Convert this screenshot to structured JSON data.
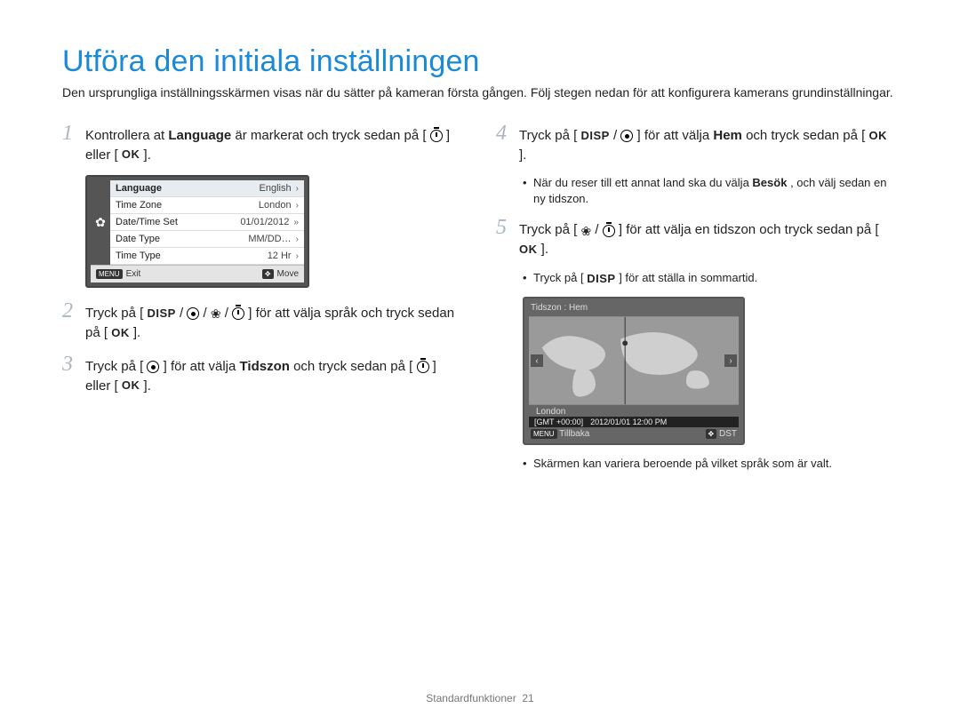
{
  "title": "Utföra den initiala inställningen",
  "intro": "Den ursprungliga inställningsskärmen visas när du sätter på kameran första gången. Följ stegen nedan för att konfigurera kamerans grundinställningar.",
  "icons": {
    "disp": "DISP",
    "ok": "OK",
    "menu": "MENU",
    "flower": "❀"
  },
  "step1": {
    "num": "1",
    "t1": "Kontrollera at ",
    "bold1": "Language",
    "t2": " är markerat och tryck sedan på [",
    "t3": "] eller [",
    "t4": "]."
  },
  "settings_lcd": {
    "rows": [
      {
        "label": "Language",
        "value": "English",
        "chev": "›",
        "selected": true
      },
      {
        "label": "Time Zone",
        "value": "London",
        "chev": "›"
      },
      {
        "label": "Date/Time Set",
        "value": "01/01/2012",
        "chev": "»"
      },
      {
        "label": "Date Type",
        "value": "MM/DD…",
        "chev": "›"
      },
      {
        "label": "Time Type",
        "value": "12 Hr",
        "chev": "›"
      }
    ],
    "foot_left": "Exit",
    "foot_right": "Move"
  },
  "step2": {
    "num": "2",
    "t1": "Tryck på [",
    "sep": "/",
    "t2": "] för att välja språk och tryck sedan på [",
    "t3": "]."
  },
  "step3": {
    "num": "3",
    "t1": "Tryck på [",
    "t2": "] för att välja ",
    "bold": "Tidszon",
    "t3": " och tryck sedan på [",
    "t4": "] eller [",
    "t5": "]."
  },
  "step4": {
    "num": "4",
    "t1": "Tryck på [",
    "sep": "/",
    "t2": "] för att välja ",
    "bold": "Hem",
    "t3": " och tryck sedan på [",
    "t4": "]."
  },
  "step4_bullet": {
    "t1": "När du reser till ett annat land ska du välja ",
    "bold": "Besök",
    "t2": ", och välj sedan en ny tidszon."
  },
  "step5": {
    "num": "5",
    "t1": "Tryck på [",
    "sep": "/",
    "t2": "] för att välja en tidszon och tryck sedan på [",
    "t3": "]."
  },
  "step5_bullet": {
    "t1": "Tryck på [",
    "t2": "] för att ställa in sommartid."
  },
  "tz_lcd": {
    "head": "Tidszon : Hem",
    "city": "London",
    "gmt": "[GMT +00:00]",
    "datetime": "2012/01/01 12:00 PM",
    "foot_left": "Tillbaka",
    "foot_right": "DST"
  },
  "final_bullet": "Skärmen kan variera beroende på vilket språk som är valt.",
  "footer": {
    "label": "Standardfunktioner",
    "page": "21"
  }
}
